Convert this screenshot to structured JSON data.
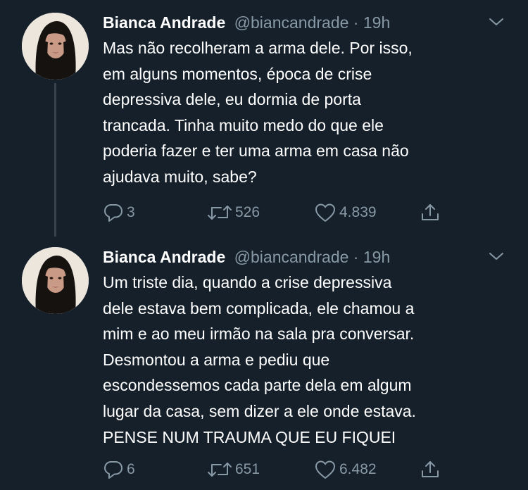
{
  "tweets": [
    {
      "author": {
        "name": "Bianca Andrade",
        "handle": "@biancandrade",
        "separator": "·",
        "time": "19h",
        "avatar_icon": "profile-photo"
      },
      "text_lines": [
        "Mas não recolheram a arma dele. Por isso,",
        "em alguns momentos, época de crise",
        "depressiva dele, eu dormia de porta",
        "trancada. Tinha muito medo do que ele",
        "poderia fazer e ter uma arma em casa não",
        "ajudava muito, sabe?"
      ],
      "actions": {
        "reply_count": "3",
        "retweet_count": "526",
        "like_count": "4.839"
      }
    },
    {
      "author": {
        "name": "Bianca Andrade",
        "handle": "@biancandrade",
        "separator": "·",
        "time": "19h",
        "avatar_icon": "profile-photo"
      },
      "text_lines": [
        "Um triste dia, quando a crise depressiva",
        "dele estava bem complicada, ele chamou a",
        "mim e ao meu irmão na sala pra conversar.",
        "Desmontou a arma e pediu que",
        "escondessemos cada parte dela em algum",
        "lugar da casa, sem dizer a ele onde estava.",
        "PENSE NUM TRAUMA QUE EU FIQUEI"
      ],
      "actions": {
        "reply_count": "6",
        "retweet_count": "651",
        "like_count": "6.482"
      }
    }
  ],
  "colors": {
    "background": "#15202b",
    "primary_text": "#ffffff",
    "secondary_text": "#8899a6",
    "thread_line": "#38444d"
  },
  "icons": [
    "reply-icon",
    "retweet-icon",
    "like-icon",
    "share-icon",
    "chevron-down-icon"
  ]
}
